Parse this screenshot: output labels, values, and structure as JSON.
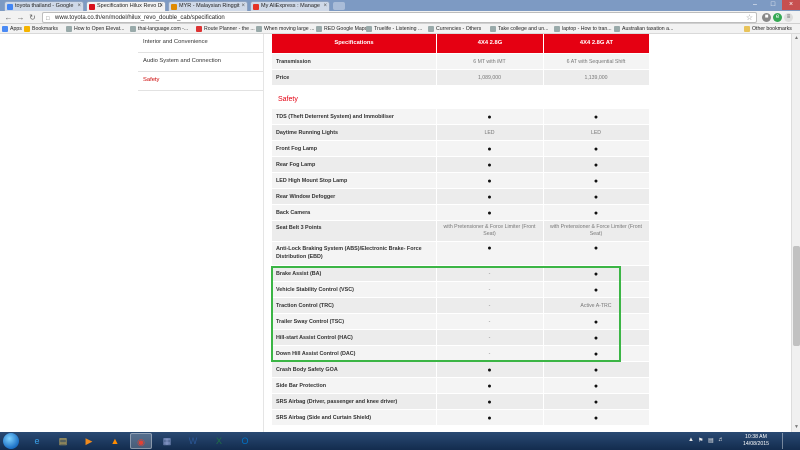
{
  "browser": {
    "tabs": [
      {
        "label": "toyota thailand - Google",
        "icon": "google-icon",
        "color": "#4285f4"
      },
      {
        "label": "Specification Hilux Revo D",
        "icon": "toyota-icon",
        "color": "#d8101c",
        "active": true
      },
      {
        "label": "MYR - Malaysian Ringgit",
        "icon": "currency-icon",
        "color": "#e08a00"
      },
      {
        "label": "My AliExpress : Manage",
        "icon": "aliexpress-icon",
        "color": "#e43225"
      }
    ],
    "url": "www.toyota.co.th/en/model/hilux_revo_double_cab/specification",
    "bookmarks": [
      {
        "label": "Apps",
        "icon": "apps-icon"
      },
      {
        "label": "Bookmarks",
        "icon": "star-icon"
      },
      {
        "label": "How to Open Elevat...",
        "icon": "page-icon"
      },
      {
        "label": "thai-language.com -...",
        "icon": "page-icon"
      },
      {
        "label": "Route Planner - the ...",
        "icon": "map-icon"
      },
      {
        "label": "When moving large ...",
        "icon": "page-icon"
      },
      {
        "label": "RED Google Maps",
        "icon": "page-icon"
      },
      {
        "label": "Truelife - Listening ...",
        "icon": "page-icon"
      },
      {
        "label": "Currencies - Others",
        "icon": "page-icon"
      },
      {
        "label": "Take college and un...",
        "icon": "page-icon"
      },
      {
        "label": "laptop - How to tran...",
        "icon": "page-icon"
      },
      {
        "label": "Australian taxation a...",
        "icon": "page-icon"
      },
      {
        "label": "Other bookmarks",
        "icon": "folder-icon"
      }
    ]
  },
  "sidebar": {
    "items": [
      {
        "label": "Interior and Convenience",
        "active": false
      },
      {
        "label": "Audio System and Connection",
        "active": false
      },
      {
        "label": "Safety",
        "active": true
      }
    ]
  },
  "spec": {
    "header": {
      "label": "Specifications",
      "col1": "4X4 2.8G",
      "col2": "4X4 2.8G AT"
    },
    "top_rows": [
      {
        "label": "Transmission",
        "v1": "6 MT with iMT",
        "v2": "6 AT with Sequential Shift"
      },
      {
        "label": "Price",
        "v1": "1,089,000",
        "v2": "1,139,000"
      }
    ],
    "section_title": "Safety",
    "safety_rows": [
      {
        "label": "TDS (Theft Deterrent System) and Immobiliser",
        "v1": "●",
        "v2": "●"
      },
      {
        "label": "Daytime Running Lights",
        "v1": "LED",
        "v2": "LED"
      },
      {
        "label": "Front Fog Lamp",
        "v1": "●",
        "v2": "●"
      },
      {
        "label": "Rear Fog Lamp",
        "v1": "●",
        "v2": "●"
      },
      {
        "label": "LED High Mount Stop Lamp",
        "v1": "●",
        "v2": "●"
      },
      {
        "label": "Rear Window Defogger",
        "v1": "●",
        "v2": "●"
      },
      {
        "label": "Back Camera",
        "v1": "●",
        "v2": "●"
      },
      {
        "label": "Seat Belt 3 Points",
        "v1": "with Pretensioner & Force Limiter (Front Seat)",
        "v2": "with Pretensioner & Force Limiter (Front Seat)"
      },
      {
        "label": "Anti-Lock Braking System (ABS)/Electronic Brake- Force Distribution (EBD)",
        "v1": "●",
        "v2": "●"
      },
      {
        "label": "Brake Assist (BA)",
        "v1": "-",
        "v2": "●"
      },
      {
        "label": "Vehicle Stability Control (VSC)",
        "v1": "-",
        "v2": "●"
      },
      {
        "label": "Traction Control (TRC)",
        "v1": "-",
        "v2": "Active A-TRC"
      },
      {
        "label": "Trailer Sway Control (TSC)",
        "v1": "-",
        "v2": "●"
      },
      {
        "label": "Hill-start Assist Control (HAC)",
        "v1": "-",
        "v2": "●"
      },
      {
        "label": "Down Hill Assist Control (DAC)",
        "v1": "-",
        "v2": "●"
      },
      {
        "label": "Crash Body Safety GOA",
        "v1": "●",
        "v2": "●"
      },
      {
        "label": "Side Bar Protection",
        "v1": "●",
        "v2": "●"
      },
      {
        "label": "SRS Airbag (Driver, passenger and knee driver)",
        "v1": "●",
        "v2": "●"
      },
      {
        "label": "SRS Airbag (Side and Curtain Shield)",
        "v1": "●",
        "v2": "●"
      }
    ]
  },
  "taskbar": {
    "apps": [
      {
        "name": "ie-icon",
        "glyph": "e",
        "color": "#3aa0e8"
      },
      {
        "name": "explorer-icon",
        "glyph": "▤",
        "color": "#e8c35a"
      },
      {
        "name": "media-icon",
        "glyph": "▶",
        "color": "#f08a1c"
      },
      {
        "name": "vlc-icon",
        "glyph": "▲",
        "color": "#ff8c00"
      },
      {
        "name": "chrome-icon",
        "glyph": "◉",
        "color": "#e34133",
        "active": true
      },
      {
        "name": "apps-icon",
        "glyph": "▦",
        "color": "#9ad"
      },
      {
        "name": "word-icon",
        "glyph": "W",
        "color": "#2b5797"
      },
      {
        "name": "excel-icon",
        "glyph": "X",
        "color": "#1e7145"
      },
      {
        "name": "outlook-icon",
        "glyph": "O",
        "color": "#0072c6"
      }
    ],
    "time": "10:38 AM",
    "date": "14/08/2015"
  }
}
